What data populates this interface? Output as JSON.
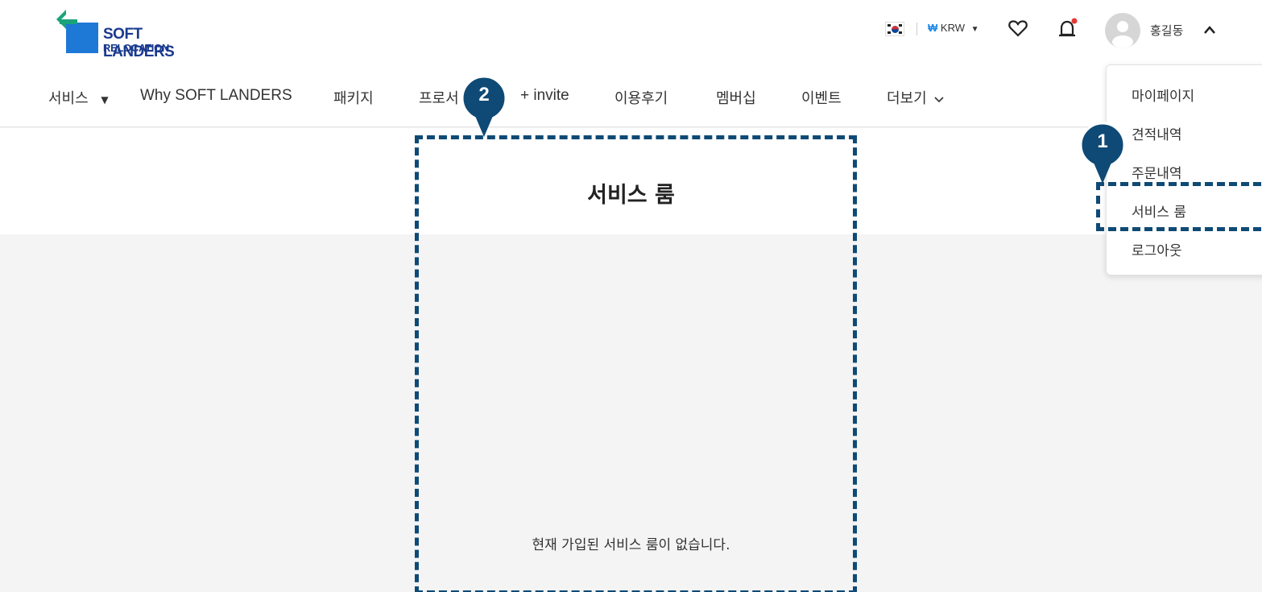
{
  "header": {
    "logo_line1": "SOFT LANDERS",
    "logo_line2": "RELOCATION",
    "currency_symbol": "₩",
    "currency_code": "KRW",
    "username": "홍길동"
  },
  "nav": {
    "items": [
      {
        "label": "서비스"
      },
      {
        "label": "Why SOFT LANDERS"
      },
      {
        "label": "패키지"
      },
      {
        "label": "프로서"
      },
      {
        "label": "+ invite"
      },
      {
        "label": "이용후기"
      },
      {
        "label": "멤버십"
      },
      {
        "label": "이벤트"
      },
      {
        "label": "더보기"
      }
    ]
  },
  "main": {
    "title": "서비스 룸",
    "empty_message": "현재 가입된 서비스 룸이 없습니다."
  },
  "user_menu": {
    "items": [
      {
        "label": "마이페이지"
      },
      {
        "label": "견적내역"
      },
      {
        "label": "주문내역"
      },
      {
        "label": "서비스 룸"
      },
      {
        "label": "로그아웃"
      }
    ]
  },
  "annotations": {
    "marker1": "1",
    "marker2": "2"
  },
  "colors": {
    "annotation": "#0e4a75",
    "brand_blue": "#1a3a8f",
    "logo_teal": "#1aa37a",
    "currency_accent": "#1e88e5",
    "notification_dot": "#e53935"
  }
}
